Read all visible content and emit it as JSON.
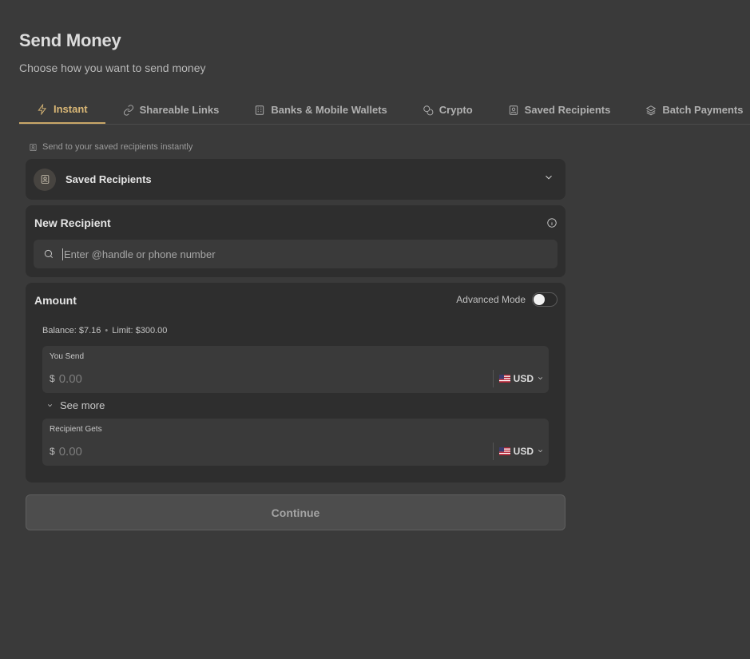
{
  "page": {
    "title": "Send Money",
    "subtitle": "Choose how you want to send money"
  },
  "tabs": [
    {
      "label": "Instant",
      "icon": "lightning-icon",
      "active": true
    },
    {
      "label": "Shareable Links",
      "icon": "link-icon",
      "active": false
    },
    {
      "label": "Banks & Mobile Wallets",
      "icon": "bank-icon",
      "active": false
    },
    {
      "label": "Crypto",
      "icon": "coins-icon",
      "active": false
    },
    {
      "label": "Saved Recipients",
      "icon": "contact-icon",
      "active": false
    },
    {
      "label": "Batch Payments",
      "icon": "layers-icon",
      "active": false
    }
  ],
  "saved": {
    "hint": "Send to your saved recipients instantly",
    "label": "Saved Recipients"
  },
  "new_recipient": {
    "title": "New Recipient",
    "placeholder": "Enter @handle or phone number"
  },
  "amount": {
    "title": "Amount",
    "advanced_mode_label": "Advanced Mode",
    "advanced_mode_on": false,
    "balance": "Balance: $7.16",
    "separator": "•",
    "limit": "Limit: $300.00",
    "you_send_label": "You Send",
    "recipient_gets_label": "Recipient Gets",
    "currency_symbol": "$",
    "amount_placeholder": "0.00",
    "send_currency": "USD",
    "gets_currency": "USD",
    "see_more_label": "See more"
  },
  "continue_label": "Continue",
  "colors": {
    "background": "#3a3a3a",
    "card": "#2e2e2e",
    "accent": "#c9a768"
  }
}
